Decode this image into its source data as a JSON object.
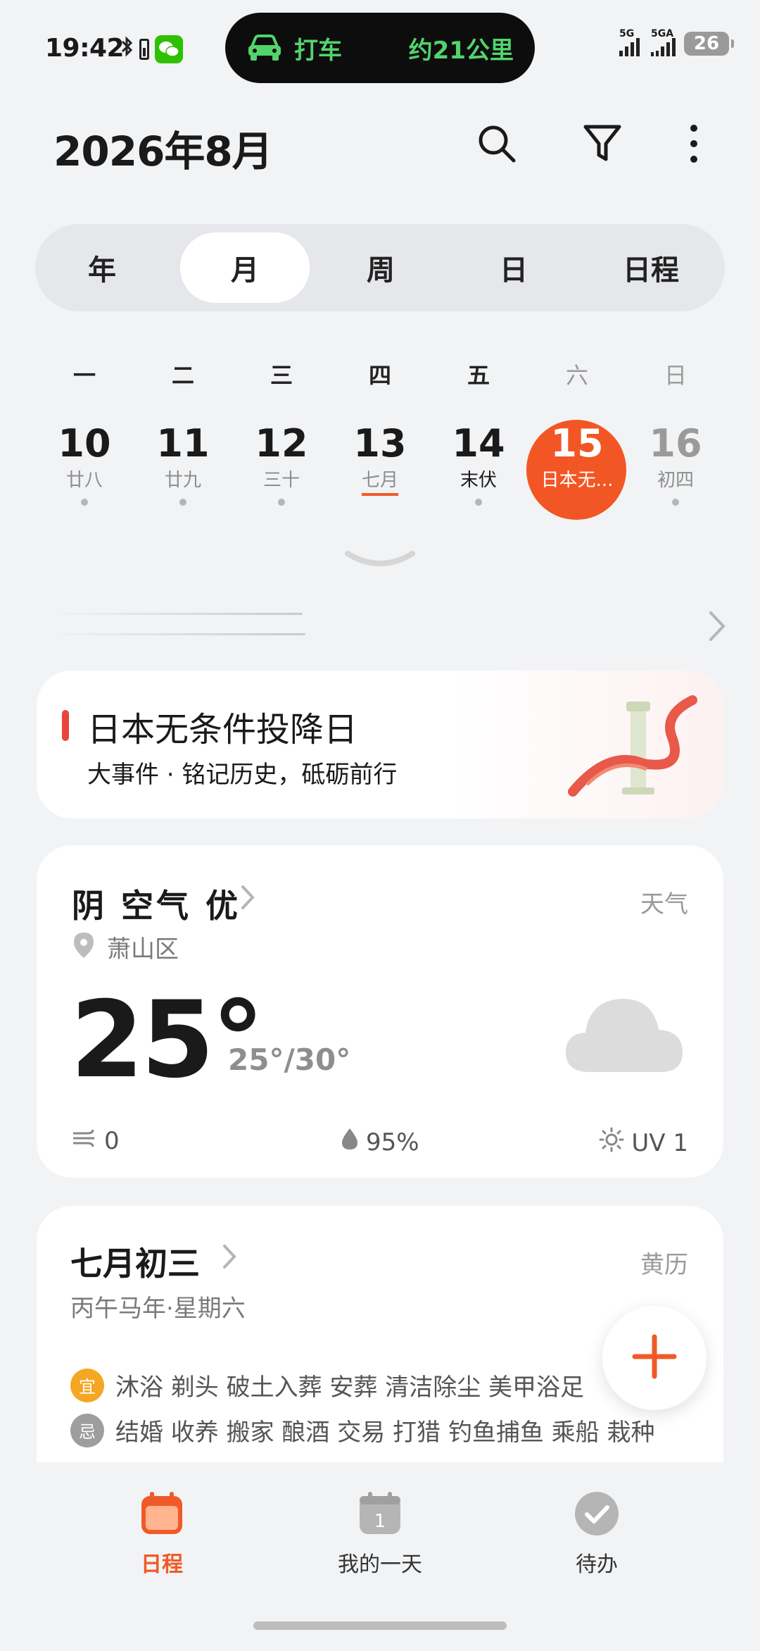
{
  "status_bar": {
    "time": "19:42",
    "island_left": "打车",
    "island_right": "约21公里",
    "signal1_label": "5G",
    "signal2_label": "5GA",
    "battery": "26"
  },
  "header": {
    "title": "2026年8月"
  },
  "view_tabs": [
    {
      "label": "年"
    },
    {
      "label": "月"
    },
    {
      "label": "周"
    },
    {
      "label": "日"
    },
    {
      "label": "日程"
    }
  ],
  "active_tab": "月",
  "weekdays": [
    "一",
    "二",
    "三",
    "四",
    "五",
    "六",
    "日"
  ],
  "days": [
    {
      "num": "10",
      "sub": "廿八"
    },
    {
      "num": "11",
      "sub": "廿九"
    },
    {
      "num": "12",
      "sub": "三十"
    },
    {
      "num": "13",
      "sub": "七月"
    },
    {
      "num": "14",
      "sub": "末伏"
    },
    {
      "num": "15",
      "sub": "日本无..."
    },
    {
      "num": "16",
      "sub": "初四"
    }
  ],
  "event": {
    "title": "日本无条件投降日",
    "subtitle": "大事件 · 铭记历史，砥砺前行"
  },
  "weather": {
    "condition": "阴 空气 优",
    "label": "天气",
    "location": "萧山区",
    "temp": "25°",
    "range": "25°/30°",
    "wind": "0",
    "humidity": "95%",
    "uv": "UV 1"
  },
  "almanac": {
    "title": "七月初三",
    "label": "黄历",
    "subtitle": "丙午马年·星期六",
    "yi_badge": "宜",
    "yi": "沐浴 剃头 破土入葬 安葬 清洁除尘 美甲浴足",
    "ji_badge": "忌",
    "ji": "结婚 收养 搬家 酿酒 交易 打猎 钓鱼捕鱼 乘船 栽种"
  },
  "bottom_nav": [
    {
      "label": "日程"
    },
    {
      "label": "我的一天"
    },
    {
      "label": "待办"
    }
  ],
  "colors": {
    "accent": "#f25624",
    "yi": "#f5a623",
    "ji": "#9e9e9e",
    "island_green": "#52d46d"
  }
}
